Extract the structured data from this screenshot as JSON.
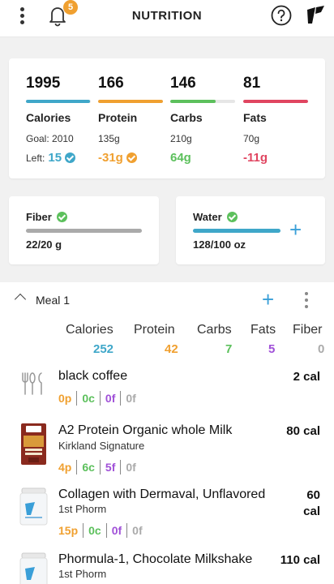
{
  "header": {
    "title": "NUTRITION",
    "notification_count": "5",
    "icons": [
      "more-vertical-icon",
      "bell-icon",
      "help-icon",
      "brand-logo-icon"
    ]
  },
  "summary": {
    "calories": {
      "value": "1995",
      "label": "Calories",
      "goal": "Goal: 2010",
      "left_prefix": "Left:",
      "left": "15",
      "color": "#3fa7c9",
      "progress": 0.99
    },
    "protein": {
      "value": "166",
      "label": "Protein",
      "goal": "135g",
      "left": "-31g",
      "color": "#f0a030",
      "progress": 1.0
    },
    "carbs": {
      "value": "146",
      "label": "Carbs",
      "goal": "210g",
      "left": "64g",
      "color": "#5cc05c",
      "progress": 0.7
    },
    "fats": {
      "value": "81",
      "label": "Fats",
      "goal": "70g",
      "left": "-11g",
      "color": "#e04560",
      "progress": 1.0
    }
  },
  "fiber": {
    "label": "Fiber",
    "value": "22/20 g",
    "color": "#aaaaaa",
    "progress": 1.0
  },
  "water": {
    "label": "Water",
    "value": "128/100 oz",
    "color": "#3fa7c9",
    "progress": 1.0
  },
  "meal": {
    "name": "Meal 1",
    "headers": {
      "calories": "Calories",
      "protein": "Protein",
      "carbs": "Carbs",
      "fats": "Fats",
      "fiber": "Fiber"
    },
    "totals": {
      "calories": "252",
      "protein": "42",
      "carbs": "7",
      "fats": "5",
      "fiber": "0"
    },
    "foods": [
      {
        "name": "black coffee",
        "brand": "",
        "cal": "2 cal",
        "p": "0p",
        "c": "0c",
        "f": "0f",
        "fi": "0f",
        "icon": "utensils-icon"
      },
      {
        "name": "A2 Protein Organic whole Milk",
        "brand": "Kirkland Signature",
        "cal": "80 cal",
        "p": "4p",
        "c": "6c",
        "f": "5f",
        "fi": "0f",
        "icon": "milk-carton-icon"
      },
      {
        "name": "Collagen with Dermaval, Unflavored",
        "brand": "1st Phorm",
        "cal_line1": "60",
        "cal_line2": "cal",
        "p": "15p",
        "c": "0c",
        "f": "0f",
        "fi": "0f",
        "icon": "supplement-tub-icon"
      },
      {
        "name": "Phormula-1, Chocolate Milkshake",
        "brand": "1st Phorm",
        "cal": "110 cal",
        "icon": "supplement-tub-icon"
      }
    ]
  },
  "colors": {
    "protein": "#f0a030",
    "carbs": "#5cc05c",
    "fats": "#a050d8",
    "fiber": "#aaaaaa",
    "calories": "#3fa7c9"
  }
}
